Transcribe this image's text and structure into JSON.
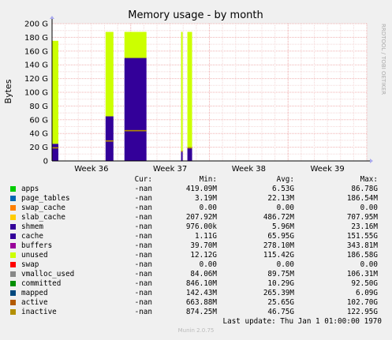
{
  "chart_data": {
    "type": "area",
    "title": "Memory usage - by month",
    "ylabel": "Bytes",
    "side_text": "RRDTOOL / TOBI OETIKER",
    "ylim": [
      0,
      200
    ],
    "y_unit": "G",
    "y_ticks": [
      "0",
      "20 G",
      "40 G",
      "60 G",
      "80 G",
      "100 G",
      "120 G",
      "140 G",
      "160 G",
      "180 G",
      "200 G"
    ],
    "x_ticks": [
      "Week 36",
      "Week 37",
      "Week 38",
      "Week 39"
    ],
    "x_tick_values": [
      0.25,
      0.5,
      0.75,
      1.0
    ],
    "bursts": [
      {
        "x0": 0.0,
        "x1": 0.02,
        "stack": {
          "cache": 25,
          "unused": 150
        },
        "inactive": 20
      },
      {
        "x0": 0.17,
        "x1": 0.195,
        "stack": {
          "cache": 65,
          "unused": 123
        },
        "inactive": 30
      },
      {
        "x0": 0.23,
        "x1": 0.3,
        "stack": {
          "cache": 150,
          "unused": 38
        },
        "inactive": 45
      },
      {
        "x0": 0.41,
        "x1": 0.415,
        "stack": {
          "cache": 15,
          "unused": 173
        },
        "inactive": 15
      },
      {
        "x0": 0.43,
        "x1": 0.445,
        "stack": {
          "cache": 20,
          "unused": 168
        },
        "inactive": 20
      }
    ],
    "series": [
      {
        "name": "apps",
        "color": "#00cc00"
      },
      {
        "name": "page_tables",
        "color": "#0066b3"
      },
      {
        "name": "swap_cache",
        "color": "#ff8000"
      },
      {
        "name": "slab_cache",
        "color": "#ffcc00"
      },
      {
        "name": "shmem",
        "color": "#330099"
      },
      {
        "name": "cache",
        "color": "#330099"
      },
      {
        "name": "buffers",
        "color": "#990099"
      },
      {
        "name": "unused",
        "color": "#ccff00"
      },
      {
        "name": "swap",
        "color": "#ff0000"
      },
      {
        "name": "vmalloc_used",
        "color": "#888888"
      },
      {
        "name": "committed",
        "color": "#008f00"
      },
      {
        "name": "mapped",
        "color": "#00487d"
      },
      {
        "name": "active",
        "color": "#b35a00"
      },
      {
        "name": "inactive",
        "color": "#b38f00"
      }
    ]
  },
  "legend": {
    "headers": {
      "cur": "Cur:",
      "min": "Min:",
      "avg": "Avg:",
      "max": "Max:"
    },
    "rows": [
      {
        "name": "apps",
        "color": "#00cc00",
        "cur": "-nan",
        "min": "419.09M",
        "avg": "6.53G",
        "max": "86.78G"
      },
      {
        "name": "page_tables",
        "color": "#0066b3",
        "cur": "-nan",
        "min": "3.19M",
        "avg": "22.13M",
        "max": "186.54M"
      },
      {
        "name": "swap_cache",
        "color": "#ff8000",
        "cur": "-nan",
        "min": "0.00",
        "avg": "0.00",
        "max": "0.00"
      },
      {
        "name": "slab_cache",
        "color": "#ffcc00",
        "cur": "-nan",
        "min": "207.92M",
        "avg": "486.72M",
        "max": "707.95M"
      },
      {
        "name": "shmem",
        "color": "#330099",
        "cur": "-nan",
        "min": "976.00k",
        "avg": "5.96M",
        "max": "23.16M"
      },
      {
        "name": "cache",
        "color": "#330099",
        "cur": "-nan",
        "min": "1.11G",
        "avg": "65.95G",
        "max": "151.55G"
      },
      {
        "name": "buffers",
        "color": "#990099",
        "cur": "-nan",
        "min": "39.70M",
        "avg": "278.10M",
        "max": "343.81M"
      },
      {
        "name": "unused",
        "color": "#ccff00",
        "cur": "-nan",
        "min": "12.12G",
        "avg": "115.42G",
        "max": "186.58G"
      },
      {
        "name": "swap",
        "color": "#ff0000",
        "cur": "-nan",
        "min": "0.00",
        "avg": "0.00",
        "max": "0.00"
      },
      {
        "name": "vmalloc_used",
        "color": "#888888",
        "cur": "-nan",
        "min": "84.06M",
        "avg": "89.75M",
        "max": "106.31M"
      },
      {
        "name": "committed",
        "color": "#008f00",
        "cur": "-nan",
        "min": "846.10M",
        "avg": "10.29G",
        "max": "92.50G"
      },
      {
        "name": "mapped",
        "color": "#00487d",
        "cur": "-nan",
        "min": "142.43M",
        "avg": "265.39M",
        "max": "6.09G"
      },
      {
        "name": "active",
        "color": "#b35a00",
        "cur": "-nan",
        "min": "663.88M",
        "avg": "25.65G",
        "max": "102.70G"
      },
      {
        "name": "inactive",
        "color": "#b38f00",
        "cur": "-nan",
        "min": "874.25M",
        "avg": "46.75G",
        "max": "122.95G"
      }
    ]
  },
  "footer": "Last update: Thu Jan  1 01:00:00 1970",
  "version": "Munin 2.0.75"
}
